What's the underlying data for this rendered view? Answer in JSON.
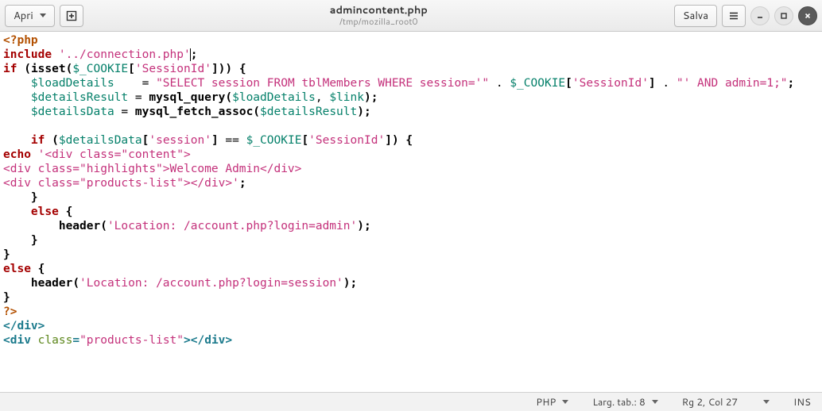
{
  "header": {
    "open_label": "Apri",
    "save_label": "Salva",
    "title": "admincontent.php",
    "subtitle": "/tmp/mozilla_root0"
  },
  "statusbar": {
    "language": "PHP",
    "tabwidth": "Larg. tab.: 8",
    "cursor": "Rg 2, Col 27",
    "mode": "INS"
  },
  "code": {
    "l01_open": "<?php",
    "l02_inc": "include",
    "l02_str": "'../connection.php'",
    "l02_semi": ";",
    "l03_if": "if",
    "l03_op": " (",
    "l03_isset": "isset",
    "l03_op2": "(",
    "l03_var": "$_COOKIE",
    "l03_br": "[",
    "l03_key": "'SessionId'",
    "l03_br2": "]",
    "l03_cl": ")) {",
    "l04_var": "$loadDetails",
    "l04_eq": "    = ",
    "l04_str": "\"SELECT session FROM tblMembers WHERE session='\"",
    "l04_dot1": " . ",
    "l04_c": "$_COOKIE",
    "l04_b": "[",
    "l04_k": "'SessionId'",
    "l04_b2": "]",
    "l04_dot2": " . ",
    "l04_str2": "\"' AND admin=1;\"",
    "l04_semi": ";",
    "l05_var": "$detailsResult",
    "l05_eq": " = ",
    "l05_fn": "mysql_query",
    "l05_op": "(",
    "l05_a1": "$loadDetails",
    "l05_c": ", ",
    "l05_a2": "$link",
    "l05_cl": ");",
    "l06_var": "$detailsData",
    "l06_eq": " = ",
    "l06_fn": "mysql_fetch_assoc",
    "l06_op": "(",
    "l06_a1": "$detailsResult",
    "l06_cl": ");",
    "l08_if": "if",
    "l08_op": " (",
    "l08_v1": "$detailsData",
    "l08_b": "[",
    "l08_k": "'session'",
    "l08_b2": "]",
    "l08_eq": " == ",
    "l08_v2": "$_COOKIE",
    "l08_b3": "[",
    "l08_k2": "'SessionId'",
    "l08_b4": "]",
    "l08_cl": ") {",
    "l09_echo": "echo",
    "l09_str": "'<div class=\"content\">",
    "l10_str": "<div class=\"highlights\">Welcome Admin</div>",
    "l11_str": "<div class=\"products-list\"></div>'",
    "l11_semi": ";",
    "l12_cb": "    }",
    "l13_else": "    else",
    "l13_ob": " {",
    "l14_fn": "        header",
    "l14_op": "(",
    "l14_str": "'Location: /account.php?login=admin'",
    "l14_cl": ");",
    "l15_cb": "    }",
    "l16_cb": "}",
    "l17_else": "else",
    "l17_ob": " {",
    "l18_fn": "    header",
    "l18_op": "(",
    "l18_str": "'Location: /account.php?login=session'",
    "l18_cl": ");",
    "l19_cb": "}",
    "l20_close": "?>",
    "l21_tag_o": "</",
    "l21_tag": "div",
    "l21_tag_c": ">",
    "l22_tag_o": "<",
    "l22_tag": "div",
    "l22_sp": " ",
    "l22_attr": "class",
    "l22_eq": "=",
    "l22_val": "\"products-list\"",
    "l22_tag_c": ">",
    "l22_tag_o2": "</",
    "l22_tag2": "div",
    "l22_tag_c2": ">"
  }
}
